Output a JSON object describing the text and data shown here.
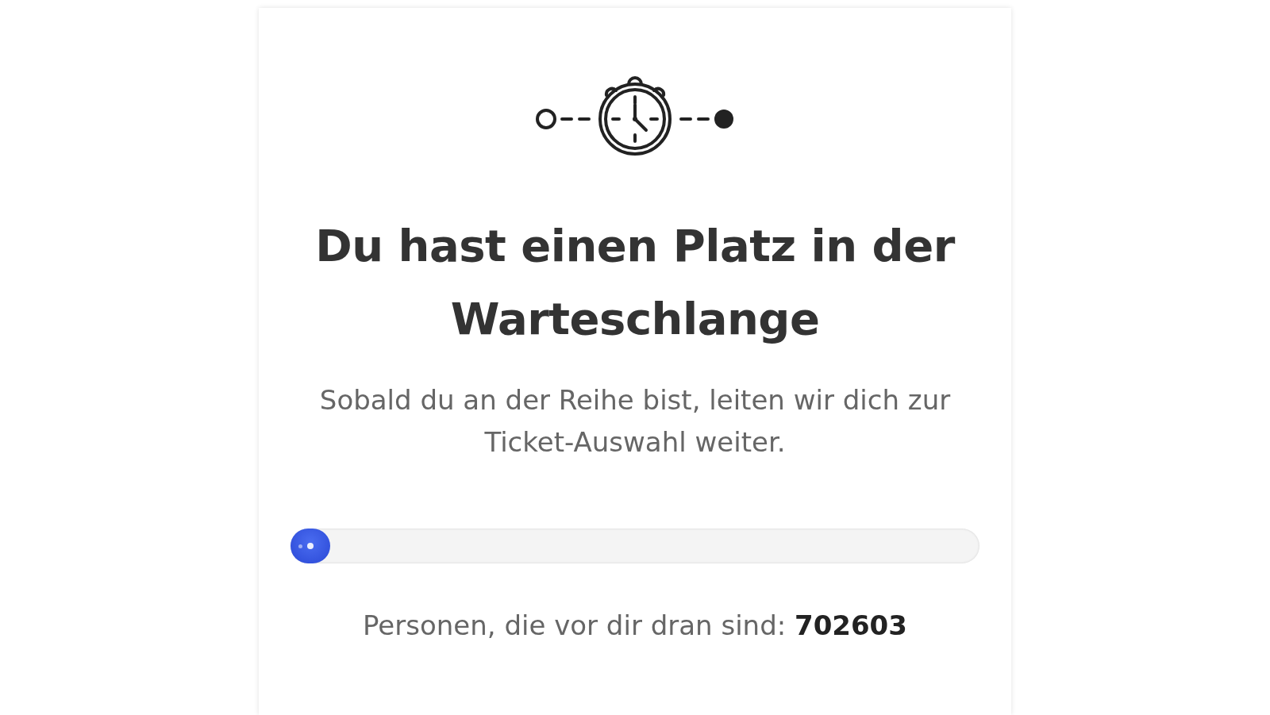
{
  "title": "Du hast einen Platz in der Warteschlange",
  "message": "Sobald du an der Reihe bist, leiten wir dich zur Ticket-Auswahl weiter.",
  "queue_info": "Personen, die vor dir dran sind: **702603**"
}
